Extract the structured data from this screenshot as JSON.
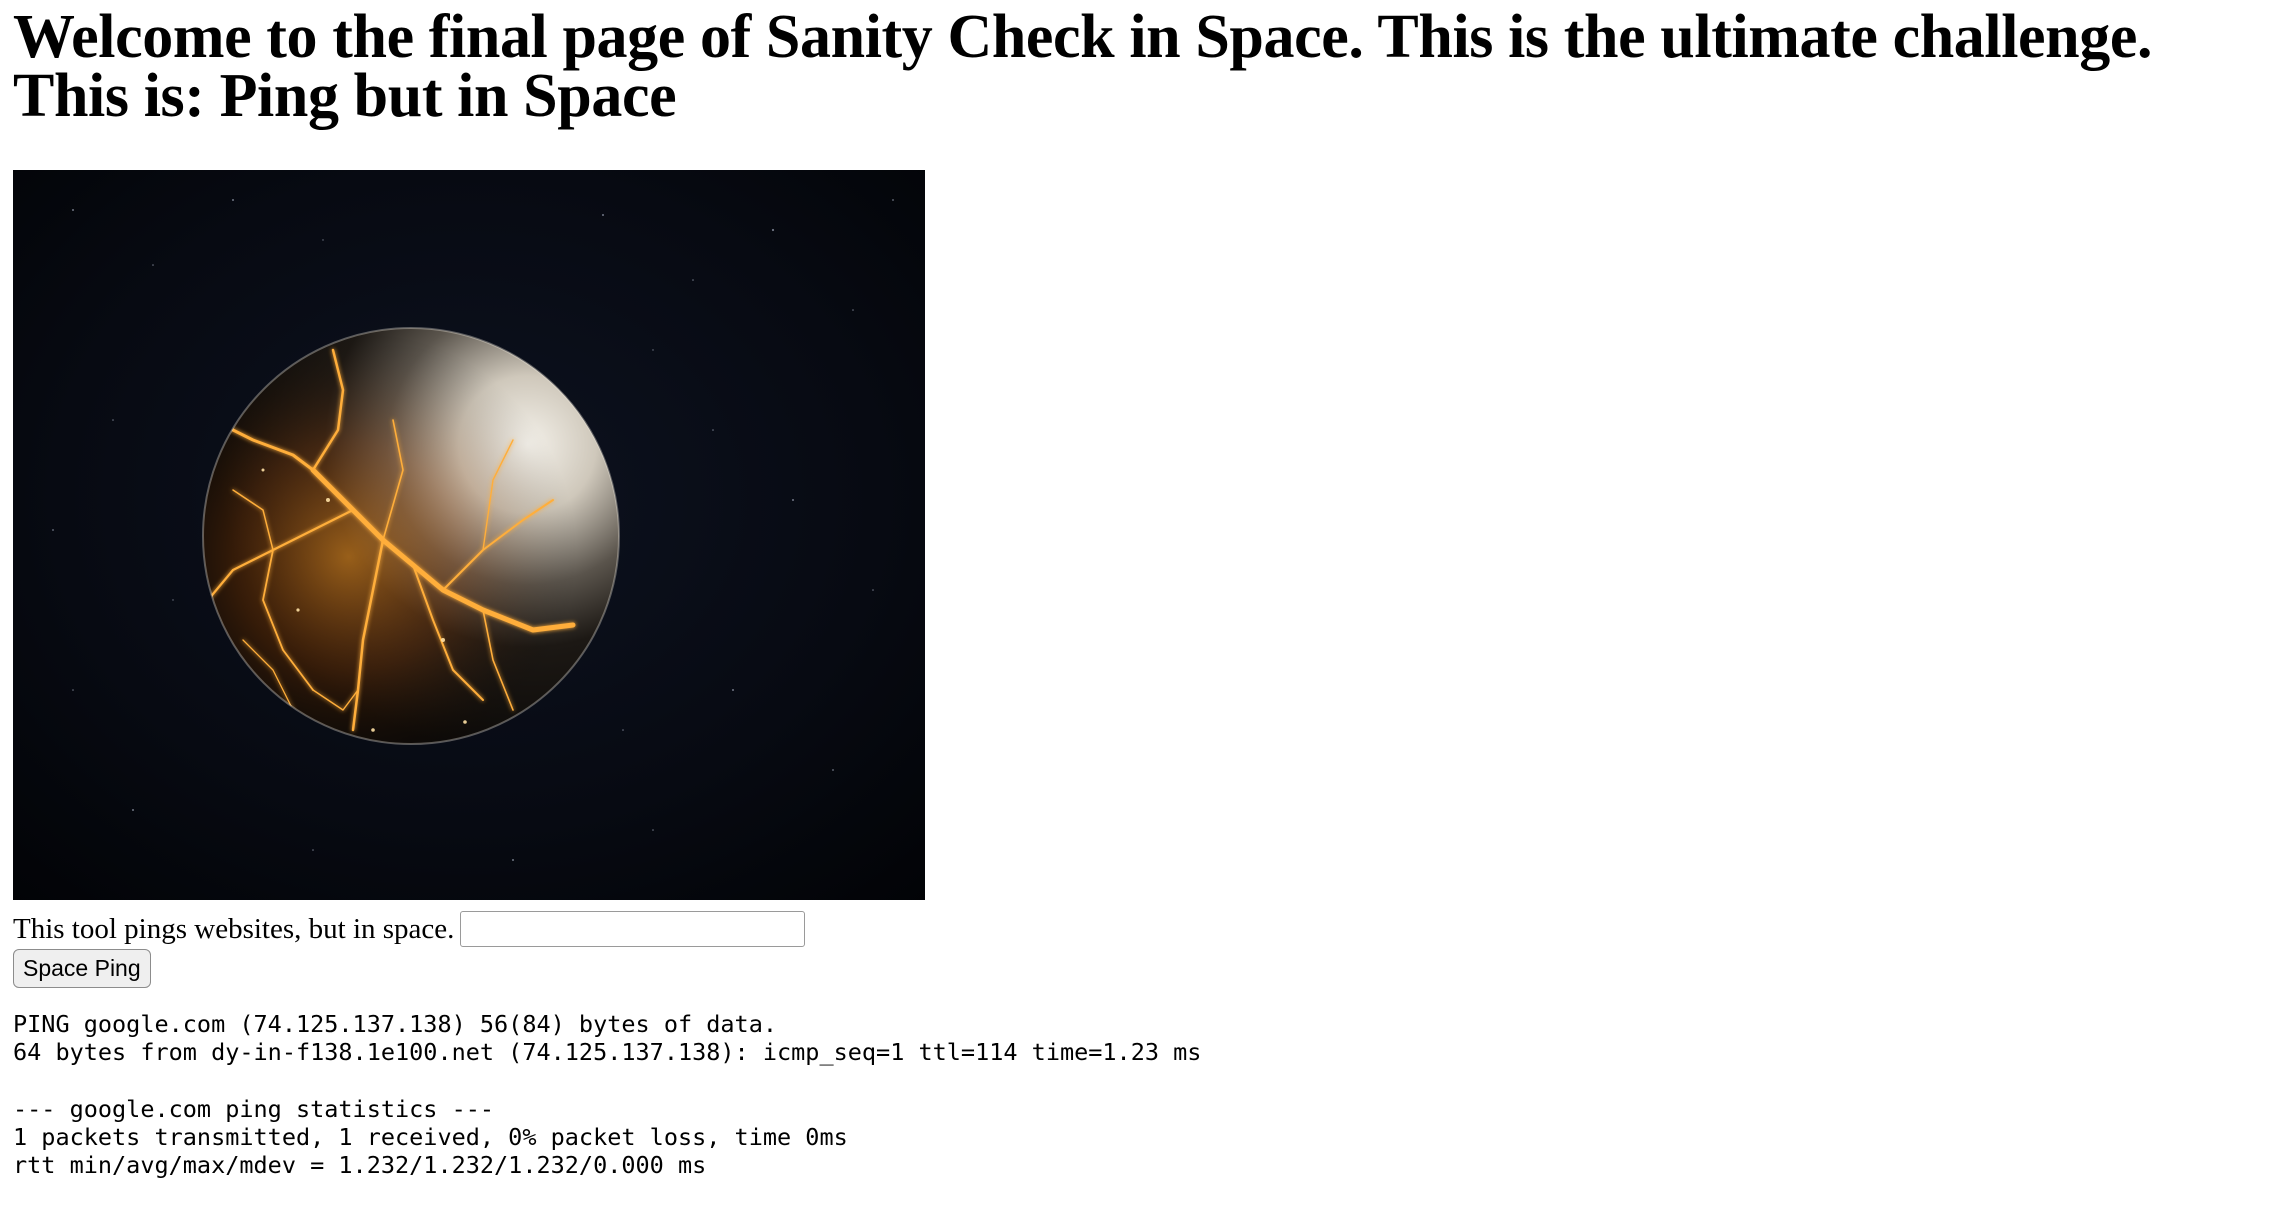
{
  "page": {
    "heading": "Welcome to the final page of Sanity Check in Space. This is the ultimate challenge. This is: Ping but in Space"
  },
  "hero_image": {
    "description": "cracked-glowing-planet-in-space"
  },
  "form": {
    "label": "This tool pings websites, but in space.",
    "input_value": "",
    "input_placeholder": "",
    "button_label": "Space Ping"
  },
  "output": {
    "lines": [
      "PING google.com (74.125.137.138) 56(84) bytes of data.",
      "64 bytes from dy-in-f138.1e100.net (74.125.137.138): icmp_seq=1 ttl=114 time=1.23 ms",
      "",
      "--- google.com ping statistics ---",
      "1 packets transmitted, 1 received, 0% packet loss, time 0ms",
      "rtt min/avg/max/mdev = 1.232/1.232/1.232/0.000 ms"
    ]
  },
  "colors": {
    "space_dark": "#05070c",
    "lava": "#ff9a1f",
    "planet_light": "#e8e2d6"
  }
}
